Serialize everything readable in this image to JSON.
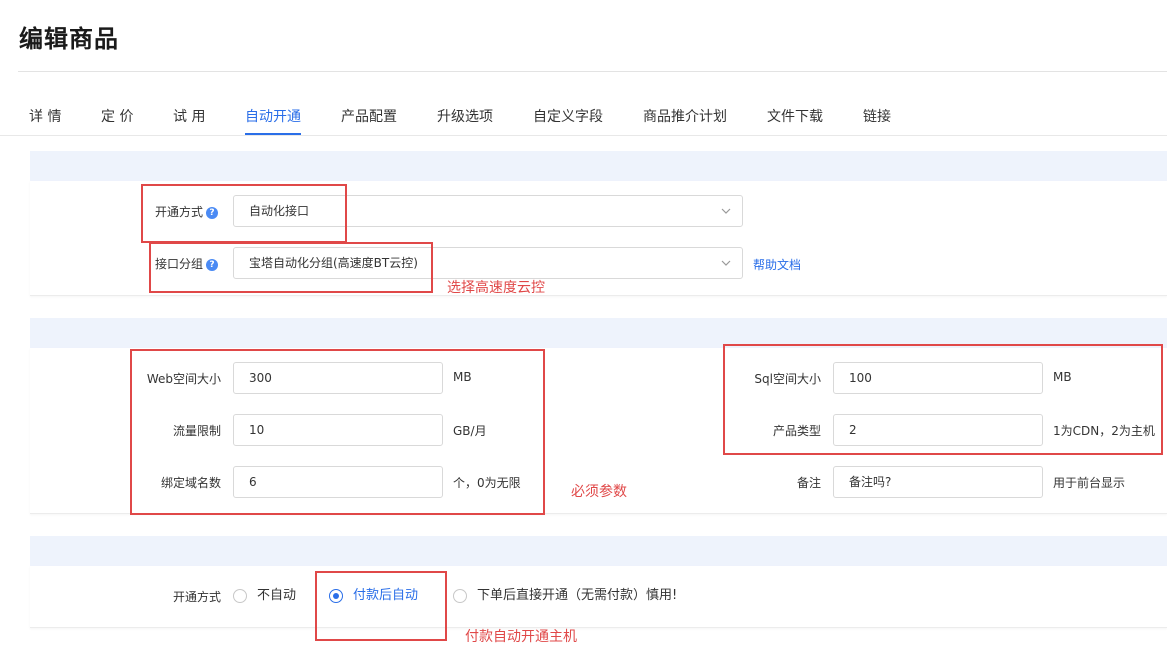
{
  "page": {
    "title": "编辑商品"
  },
  "tabs": [
    {
      "label": "详 情"
    },
    {
      "label": "定 价"
    },
    {
      "label": "试 用"
    },
    {
      "label": "自动开通"
    },
    {
      "label": "产品配置"
    },
    {
      "label": "升级选项"
    },
    {
      "label": "自定义字段"
    },
    {
      "label": "商品推介计划"
    },
    {
      "label": "文件下载"
    },
    {
      "label": "链接"
    }
  ],
  "active_tab": "自动开通",
  "section1": {
    "open_method": {
      "label": "开通方式",
      "value": "自动化接口"
    },
    "interface_group": {
      "label": "接口分组",
      "value": "宝塔自动化分组(高速度BT云控)"
    },
    "help_link": "帮助文档"
  },
  "section2": {
    "web_space": {
      "label": "Web空间大小",
      "value": "300",
      "unit": "MB"
    },
    "traffic": {
      "label": "流量限制",
      "value": "10",
      "unit": "GB/月"
    },
    "domains": {
      "label": "绑定域名数",
      "value": "6",
      "unit": "个，0为无限"
    },
    "sql_space": {
      "label": "Sql空间大小",
      "value": "100",
      "unit": "MB"
    },
    "product_type": {
      "label": "产品类型",
      "value": "2",
      "unit": "1为CDN，2为主机"
    },
    "note": {
      "label": "备注",
      "value": "备注吗?",
      "unit": "用于前台显示"
    }
  },
  "section3": {
    "label": "开通方式",
    "options": [
      {
        "label": "不自动"
      },
      {
        "label": "付款后自动"
      },
      {
        "label": "下单后直接开通（无需付款）慎用!"
      }
    ],
    "selected": "付款后自动"
  },
  "annotations": {
    "select_cloud": "选择高速度云控",
    "required_params": "必须参数",
    "auto_open": "付款自动开通主机"
  },
  "colors": {
    "accent": "#2a6ee8",
    "annotation": "#e04848",
    "section_head": "#eef3fc"
  }
}
